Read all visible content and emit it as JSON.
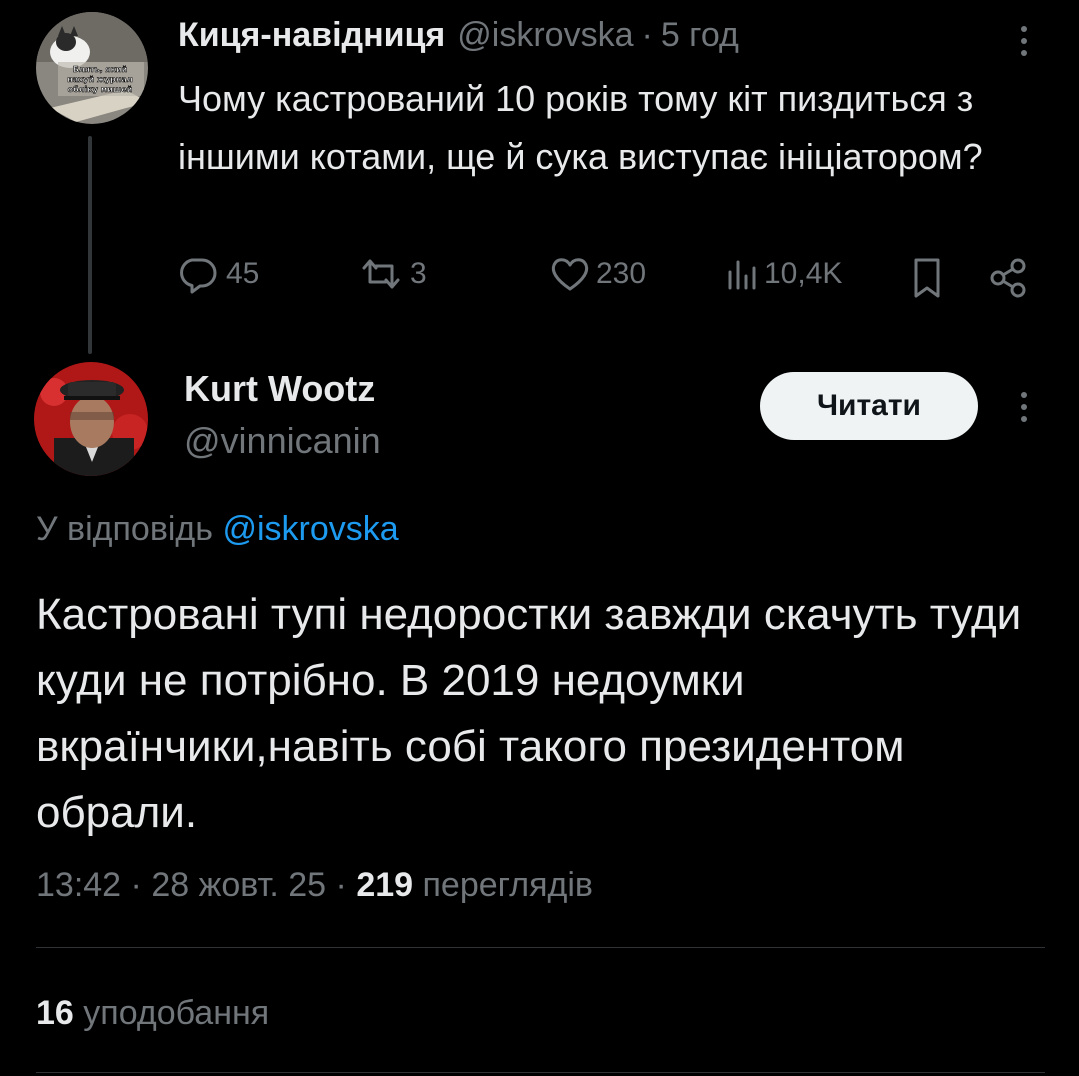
{
  "parent_tweet": {
    "author_name": "Киця-навідниця",
    "author_handle": "@iskrovska",
    "separator": "·",
    "time": "5 год",
    "avatar_caption_lines": [
      "Блять, який",
      "нахуй журнал",
      "обліку мишей"
    ],
    "text": "Чому кастрований 10 років тому кіт пиздиться з іншими котами, ще й сука виступає ініціатором?",
    "actions": {
      "replies": "45",
      "reposts": "3",
      "likes": "230",
      "views": "10,4K"
    }
  },
  "reply_tweet": {
    "author_name": "Kurt Wootz",
    "author_handle": "@vinnicanin",
    "follow_label": "Читати",
    "reply_prefix": "У відповідь",
    "reply_mention": "@iskrovska",
    "text": "Кастровані тупі недоростки завжди скачуть туди куди не потрібно. В 2019 недоумки вкраїнчики,навіть собі такого президентом обрали.",
    "timestamp": "13:42",
    "date": "28 жовт. 25",
    "dot": "·",
    "views_count": "219",
    "views_label": "переглядів",
    "likes_count": "16",
    "likes_label": "уподобання"
  },
  "colors": {
    "background": "#000000",
    "text_primary": "#e7e9ea",
    "text_secondary": "#71767b",
    "link": "#1d9bf0",
    "button_bg": "#eff3f4",
    "divider": "#2f3336"
  }
}
